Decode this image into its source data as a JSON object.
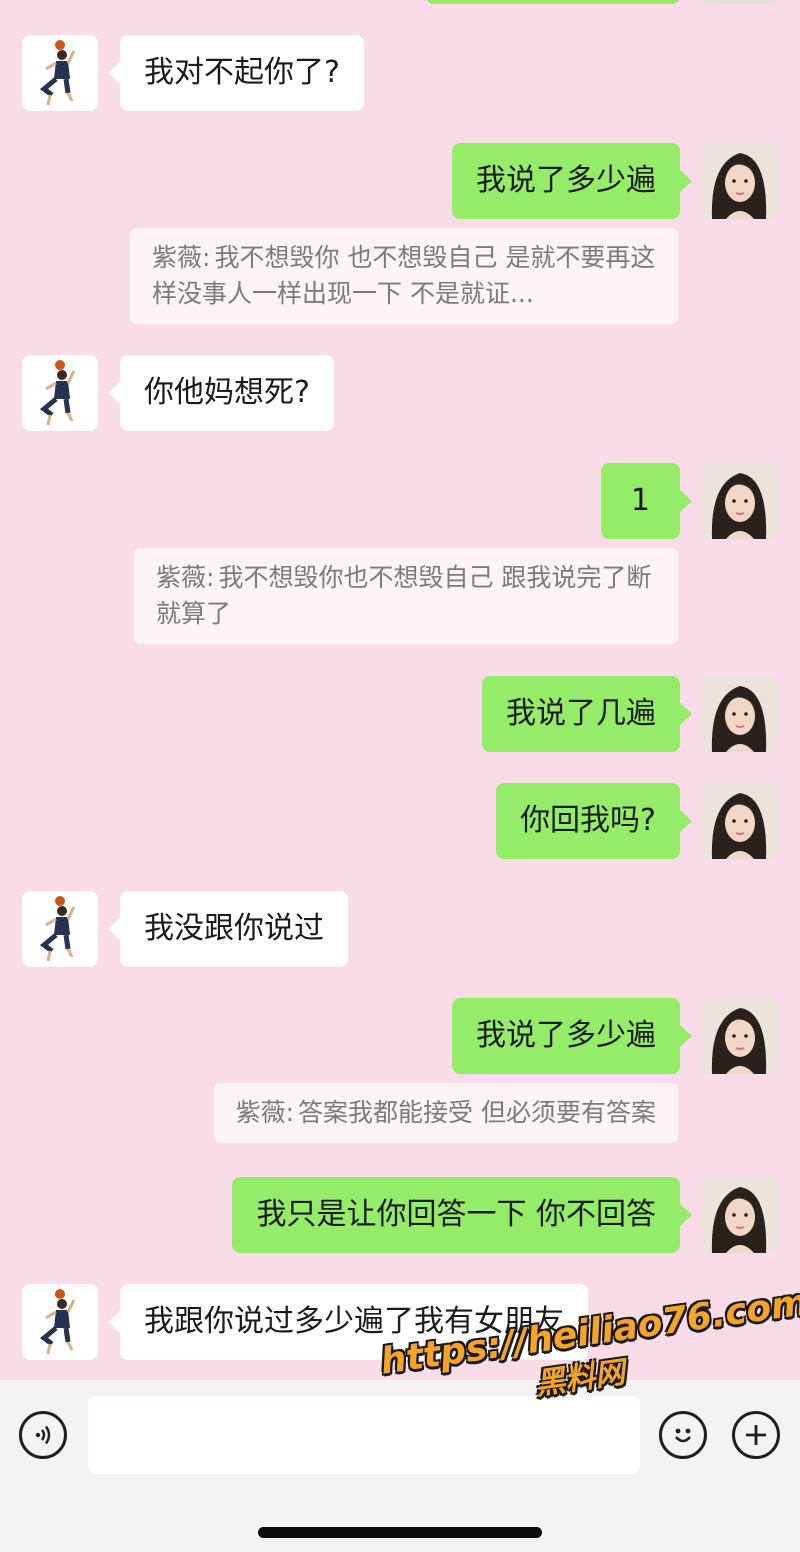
{
  "colors": {
    "background": "#f9dce8",
    "incoming_bubble": "#ffffff",
    "outgoing_bubble": "#95ec69",
    "quote_background": "#fbf3f6",
    "watermark": "#f6a32a"
  },
  "avatars": {
    "contact": "basketball-player-avatar",
    "me": "woman-portrait-avatar"
  },
  "messages": [
    {
      "side": "in",
      "text": "我对不起你了?"
    },
    {
      "side": "out",
      "text": "我说了多少遍",
      "quote": {
        "name": "紫薇:",
        "text": "我不想毁你 也不想毁自己  是就不要再这样没事人一样出现一下  不是就证..."
      }
    },
    {
      "side": "in",
      "text": "你他妈想死?"
    },
    {
      "side": "out",
      "text": "1",
      "quote": {
        "name": "紫薇:",
        "text": "我不想毁你也不想毁自己 跟我说完了断就算了"
      }
    },
    {
      "side": "out",
      "text": "我说了几遍"
    },
    {
      "side": "out",
      "text": "你回我吗?"
    },
    {
      "side": "in",
      "text": "我没跟你说过"
    },
    {
      "side": "out",
      "text": "我说了多少遍",
      "quote": {
        "name": "紫薇:",
        "text": "答案我都能接受 但必须要有答案"
      }
    },
    {
      "side": "out",
      "text": "我只是让你回答一下 你不回答"
    },
    {
      "side": "in",
      "text": "我跟你说过多少遍了我有女朋友"
    }
  ],
  "input_bar": {
    "voice_icon": "voice-icon",
    "emoji_icon": "emoji-icon",
    "add_icon": "plus-icon",
    "message_value": ""
  },
  "watermark": {
    "url": "https://heiliao76.com",
    "label": "黑料网"
  }
}
